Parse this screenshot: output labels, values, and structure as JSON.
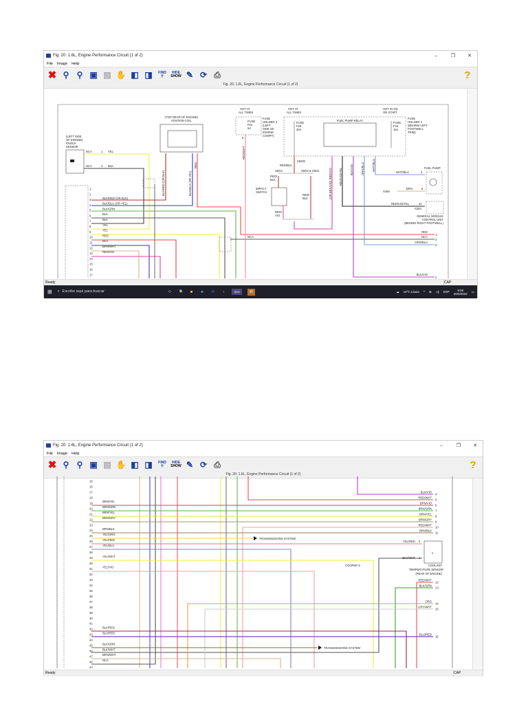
{
  "window1": {
    "title": "Fig. 20: 1.6L, Engine Performance Circuit (1 of 2)",
    "menu": [
      "File",
      "Image",
      "Help"
    ],
    "caption": "Fig. 20: 1.6L, Engine Performance Circuit (1 of 2)",
    "toolbar": {
      "hide": "HIDE",
      "show": "SHOW",
      "find": "FIND"
    },
    "status": "Ready",
    "cap": "CAP",
    "taskbar": {
      "search_placeholder": "Escribe aquí para buscar",
      "weather": "16°C  Lluvia",
      "language": "ESP",
      "time": "9:00",
      "date": "20/4/2022",
      "app_label": "SDS"
    },
    "diagram": {
      "knock_sensor": [
        "(LEFT SIDE",
        "OF ENGINE)",
        "KNOCK",
        "SENSOR"
      ],
      "knock_wires": [
        {
          "label": "NCA",
          "pin": "1",
          "color": "YEL"
        },
        {
          "label": "NCA",
          "pin": "2",
          "color": "BLK"
        }
      ],
      "coil": [
        "(TOP REAR OF ENGINE)",
        "IGNITION COIL"
      ],
      "coil_wires": [
        "BLK/RED  (OR BLK)",
        "BLK/BLU  (OR YEL)",
        "RED"
      ],
      "connector_pins": [
        {
          "pin": "1",
          "label": ""
        },
        {
          "pin": "2",
          "label": ""
        },
        {
          "pin": "3",
          "label": "BLK/RED   (OR BLK)"
        },
        {
          "pin": "4",
          "label": "BLK/BLU   (OR YEL)"
        },
        {
          "pin": "5",
          "label": "BLK/GRN"
        },
        {
          "pin": "6",
          "label": "BLK"
        },
        {
          "pin": "7",
          "label": "BLK"
        },
        {
          "pin": "8",
          "label": "YEL"
        },
        {
          "pin": "9",
          "label": "YEL"
        },
        {
          "pin": "10",
          "label": "RED"
        },
        {
          "pin": "11",
          "label": "BLU"
        },
        {
          "pin": "12",
          "label": "BRN/WHT"
        },
        {
          "pin": "13",
          "label": "RED/VIO"
        },
        {
          "pin": "14",
          "label": ""
        },
        {
          "pin": "15",
          "label": ""
        },
        {
          "pin": "16",
          "label": ""
        },
        {
          "pin": "17",
          "label": ""
        }
      ],
      "nca_mid": "NCA",
      "fuse_holder3": {
        "hot": [
          "HOT AT",
          "ALL TIMES"
        ],
        "fuse": [
          "FUSE",
          "F01",
          "5A"
        ],
        "label": [
          "FUSE",
          "HOLDER 3",
          "(LEFT",
          "SIDE OF",
          "ENGINE",
          "COMPT)"
        ],
        "wire": "RED/WHT",
        "pin": "6"
      },
      "fuse_holder2": {
        "hot1": [
          "HOT AT",
          "ALL TIMES"
        ],
        "fuse1": [
          "FUSE",
          "F28",
          "20A"
        ],
        "hot2": [
          "HOT IN ON",
          "OR START"
        ],
        "fuse2": [
          "FUSE",
          "F34",
          "15A"
        ],
        "label": [
          "FUSE",
          "HOLDER 2",
          "(BEHIND LEFT",
          "FOOTWELL",
          "TRIM)"
        ],
        "relay": "FUEL PUMP RELAY"
      },
      "splice": {
        "wire": "RED/BLK",
        "conn": "X8282",
        "left": "X8G3",
        "right": "X8G3 & X8G4"
      },
      "impact_switch": {
        "label": [
          "IMPACT",
          "SWITCH"
        ],
        "top_wire": [
          "RED/",
          "BLK"
        ],
        "bottom_wire": [
          "RED/",
          "VIO"
        ],
        "right_wire": [
          "RED/",
          "BLK"
        ]
      },
      "relay_wires": [
        "(OR BRN/VIO) RED/VIO",
        "RED/VIO/YEL",
        "BLK/VIO",
        "GRN/BLU",
        "WHT/BLU"
      ],
      "fuel_pump": {
        "label": "FUEL PUMP",
        "wire1": "WHT/BLU",
        "pin1": "2",
        "wire2": "BRN",
        "pin2": "5",
        "ground": "X490"
      },
      "gmcu": {
        "wire": "RED/VIO/YEL",
        "pin": "31",
        "conn": "X284",
        "label": [
          "GENERAL MODULE",
          "CONTROL UNIT",
          "(BEHIND RIGHT FOOTWELL)"
        ]
      },
      "right_outputs": [
        {
          "label": "RED",
          "pin": "1"
        },
        {
          "label": "NCA",
          "pin": "2"
        },
        {
          "label": "GRN/BLU",
          "pin": "3"
        },
        {
          "label": "BLK/VIO",
          "pin": "4"
        }
      ]
    }
  },
  "window2": {
    "title": "Fig. 20: 1.6L, Engine Performance Circuit (1 of 2)",
    "menu": [
      "File",
      "Image",
      "Help"
    ],
    "caption": "Fig. 20: 1.6L, Engine Performance Circuit (1 of 2)",
    "toolbar": {
      "hide": "HIDE",
      "show": "SHOW",
      "find": "FIND"
    },
    "status": "Ready",
    "cap": "CAP",
    "diagram": {
      "connector_pins": [
        {
          "pin": "15",
          "label": ""
        },
        {
          "pin": "16",
          "label": ""
        },
        {
          "pin": "17",
          "label": ""
        },
        {
          "pin": "18",
          "label": ""
        },
        {
          "pin": "19",
          "label": "BRN/VIO"
        },
        {
          "pin": "20",
          "label": "BRN/GRN"
        },
        {
          "pin": "21",
          "label": "BRN/YEL"
        },
        {
          "pin": "22",
          "label": "BRN/GRY"
        },
        {
          "pin": "23",
          "label": ""
        },
        {
          "pin": "24",
          "label": "BRN/BLK"
        },
        {
          "pin": "25",
          "label": "YEL/ORG"
        },
        {
          "pin": "26",
          "label": "YEL/RED"
        },
        {
          "pin": "27",
          "label": "YEL/BLU"
        },
        {
          "pin": "28",
          "label": ""
        },
        {
          "pin": "29",
          "label": "YEL/WHT"
        },
        {
          "pin": "30",
          "label": ""
        },
        {
          "pin": "31",
          "label": "YEL/VIO"
        },
        {
          "pin": "32",
          "label": ""
        },
        {
          "pin": "33",
          "label": ""
        },
        {
          "pin": "34",
          "label": ""
        },
        {
          "pin": "35",
          "label": ""
        },
        {
          "pin": "36",
          "label": ""
        },
        {
          "pin": "37",
          "label": ""
        },
        {
          "pin": "38",
          "label": ""
        },
        {
          "pin": "39",
          "label": ""
        },
        {
          "pin": "40",
          "label": ""
        },
        {
          "pin": "41",
          "label": ""
        },
        {
          "pin": "42",
          "label": "BLK/RED"
        },
        {
          "pin": "43",
          "label": "BLU/RED"
        },
        {
          "pin": "44",
          "label": ""
        },
        {
          "pin": "45",
          "label": "BLK/GRN"
        },
        {
          "pin": "46",
          "label": "BLK/WHT"
        },
        {
          "pin": "47",
          "label": "BRN/WHT"
        },
        {
          "pin": "48",
          "label": "NCA"
        },
        {
          "pin": "49",
          "label": ""
        }
      ],
      "right_outputs": [
        {
          "label": "BLK/VIO",
          "pin": "4"
        },
        {
          "label": "RED/WHT",
          "pin": "5"
        },
        {
          "label": "BRN/VIO",
          "pin": "6"
        },
        {
          "label": "BRN/GRN",
          "pin": "7"
        },
        {
          "label": "BRN/YEL",
          "pin": "8"
        },
        {
          "label": "BRN/GRY",
          "pin": "9"
        },
        {
          "label": "RED/WHT",
          "pin": "10"
        },
        {
          "label": "BRN/BLK",
          "pin": "11"
        },
        {
          "label": "RED/WHT",
          "pin": "12"
        },
        {
          "label": "BLK/GRN",
          "pin": "13"
        },
        {
          "label": "ORG",
          "pin": "14"
        },
        {
          "label": "GRY/WHT",
          "pin": "15"
        },
        {
          "label": "BLU/RED",
          "pin": "16"
        }
      ],
      "transmission1": "TRANSMISSIONS SYSTEM",
      "transmission2": "TRANSMISSIONS SYSTEM",
      "cooper": "COOPER S",
      "sensor": {
        "wire1": "YEL/RED",
        "pin1": "2",
        "wire2": "BLK/WHT",
        "pin2": "1",
        "label": [
          "COOLANT",
          "TEMPERATURE SENSOR",
          "(REAR OF ENGINE)"
        ]
      }
    }
  },
  "colors": {
    "red": "#f04848",
    "yellow": "#f2ee3a",
    "blue": "#3434d0",
    "green": "#5fb040",
    "magenta": "#e040a0",
    "purple": "#b040c0",
    "tan": "#d4b484",
    "black": "#555555",
    "taskbar": "#1f1f2a",
    "toolbar": "#f0f0f0"
  }
}
